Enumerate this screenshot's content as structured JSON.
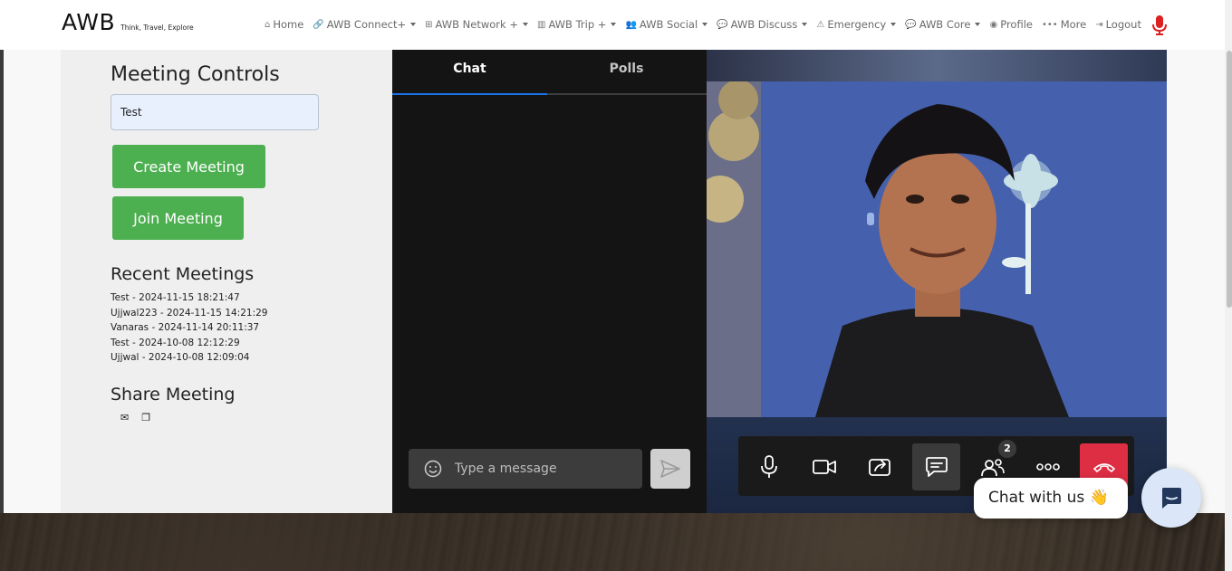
{
  "brand": {
    "name": "AWB",
    "tagline": "Think, Travel, Explore"
  },
  "nav": {
    "items": [
      {
        "label": "Home",
        "icon": "home-icon",
        "glyph": "⌂",
        "dropdown": false
      },
      {
        "label": "AWB Connect+",
        "icon": "link-icon",
        "glyph": "🔗",
        "dropdown": true
      },
      {
        "label": "AWB Network +",
        "icon": "sitemap-icon",
        "glyph": "⊞",
        "dropdown": true
      },
      {
        "label": "AWB Trip +",
        "icon": "map-icon",
        "glyph": "▥",
        "dropdown": true
      },
      {
        "label": "AWB Social",
        "icon": "users-icon",
        "glyph": "👥",
        "dropdown": true
      },
      {
        "label": "AWB Discuss",
        "icon": "comments-icon",
        "glyph": "💬",
        "dropdown": true
      },
      {
        "label": "Emergency",
        "icon": "warning-icon",
        "glyph": "⚠",
        "dropdown": true
      },
      {
        "label": "AWB Core",
        "icon": "comments-icon",
        "glyph": "💬",
        "dropdown": true
      },
      {
        "label": "Profile",
        "icon": "user-circle-icon",
        "glyph": "◉",
        "dropdown": false
      },
      {
        "label": "More",
        "icon": "ellipsis-icon",
        "glyph": "•••",
        "dropdown": false
      },
      {
        "label": "Logout",
        "icon": "logout-icon",
        "glyph": "⇥",
        "dropdown": false
      }
    ],
    "mic_icon": "microphone-icon",
    "mic_color": "#dd2020"
  },
  "controls": {
    "title": "Meeting Controls",
    "meeting_name_value": "Test",
    "create_label": "Create Meeting",
    "join_label": "Join Meeting",
    "recent_title": "Recent Meetings",
    "recent": [
      "Test - 2024-11-15 18:21:47",
      "Ujjwal223 - 2024-11-15 14:21:29",
      "Vanaras - 2024-11-14 20:11:37",
      "Test - 2024-10-08 12:12:29",
      "Ujjwal - 2024-10-08 12:09:04"
    ],
    "share_title": "Share Meeting",
    "share_icons": [
      "envelope-icon",
      "copy-icon"
    ],
    "button_color": "#4caf50"
  },
  "chat": {
    "tabs": [
      {
        "label": "Chat",
        "active": true
      },
      {
        "label": "Polls",
        "active": false
      }
    ],
    "placeholder": "Type a message",
    "accent": "#1a73e8"
  },
  "video": {
    "toolbar": [
      "microphone-icon",
      "camera-icon",
      "share-screen-icon",
      "chat-icon",
      "participants-icon",
      "more-icon",
      "hangup-icon"
    ],
    "participants_count": "2",
    "hangup_color": "#dd2e44"
  },
  "widget": {
    "label": "Chat with us",
    "emoji": "👋"
  }
}
